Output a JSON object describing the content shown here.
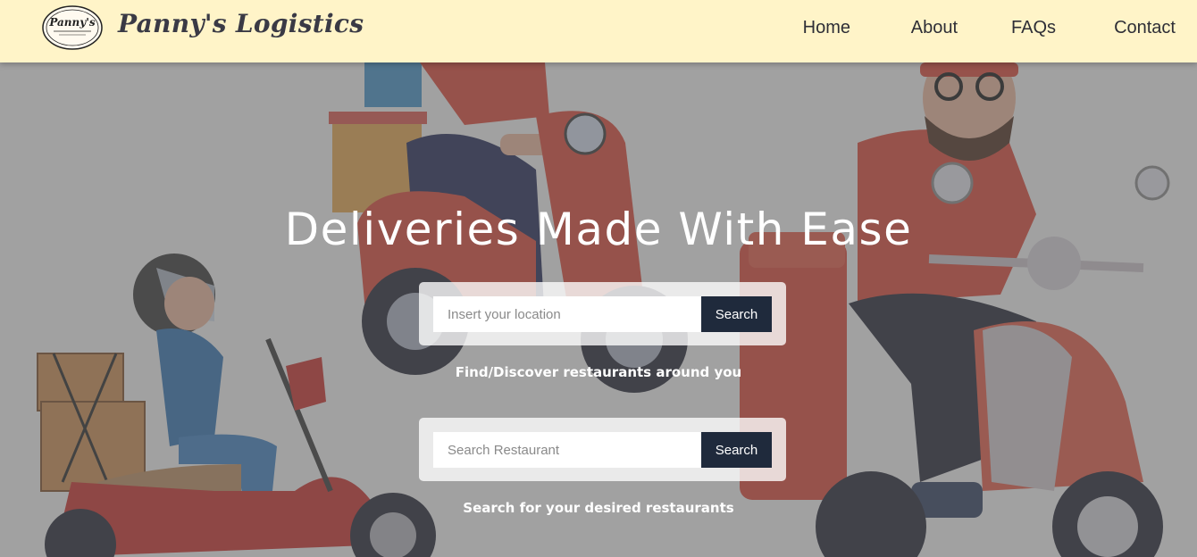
{
  "header": {
    "logo_text": "Panny's",
    "brand": "Panny's Logistics",
    "nav": [
      {
        "label": "Home"
      },
      {
        "label": "About"
      },
      {
        "label": "FAQs"
      },
      {
        "label": "Contact"
      }
    ]
  },
  "hero": {
    "title": "Deliveries Made With Ease",
    "location_search": {
      "placeholder": "Insert your location",
      "button": "Search",
      "caption": "Find/Discover restaurants around you"
    },
    "restaurant_search": {
      "placeholder": "Search Restaurant",
      "button": "Search",
      "caption": "Search for your desired restaurants"
    }
  },
  "colors": {
    "header_bg": "#fff4c8",
    "button_bg": "#1f2a3c",
    "scooter_red": "#c8312a"
  }
}
